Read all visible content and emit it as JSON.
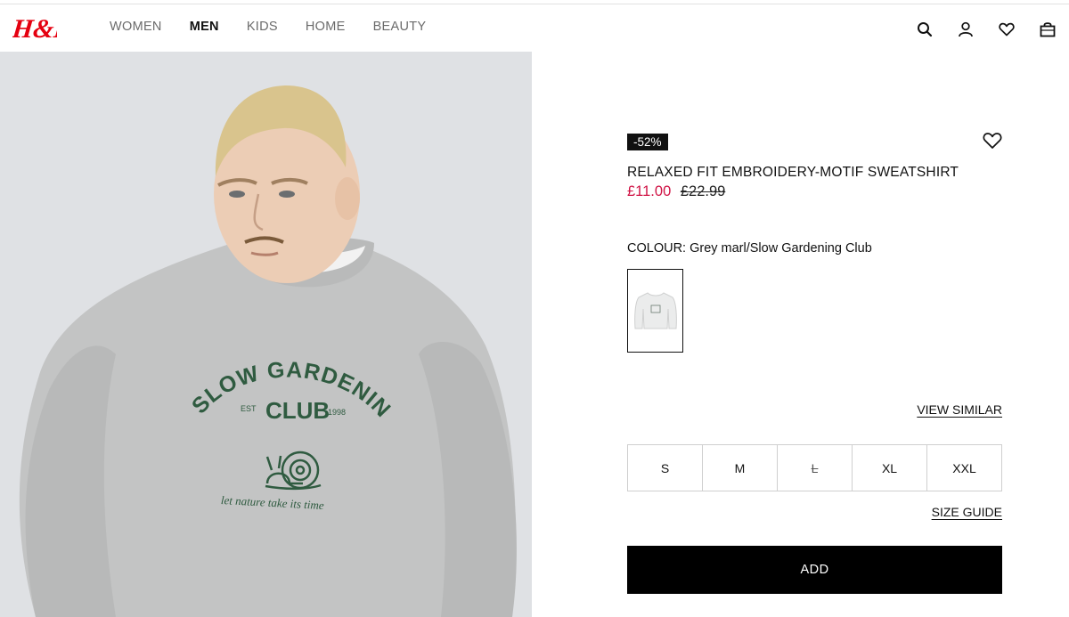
{
  "brand": {
    "logo_text": "H&M",
    "logo_color": "#e50010"
  },
  "nav": [
    "WOMEN",
    "MEN",
    "KIDS",
    "HOME",
    "BEAUTY"
  ],
  "nav_active": "MEN",
  "header_icons": [
    "search-icon",
    "account-icon",
    "favourites-icon",
    "shopping-bag-icon"
  ],
  "product": {
    "discount_badge": "-52%",
    "title": "RELAXED FIT EMBROIDERY-MOTIF SWEATSHIRT",
    "price_sale": "£11.00",
    "price_original": "£22.99",
    "colour_label": "COLOUR: Grey marl/Slow Gardening Club",
    "sale_color": "#d01345",
    "print": {
      "line1": "SLOW GARDENING",
      "line2": "CLUB",
      "est": "EST",
      "year": "1998",
      "tagline": "let nature take its time"
    }
  },
  "view_similar": "VIEW SIMILAR",
  "sizes": [
    {
      "label": "S",
      "available": true
    },
    {
      "label": "M",
      "available": true
    },
    {
      "label": "L",
      "available": false
    },
    {
      "label": "XL",
      "available": true
    },
    {
      "label": "XXL",
      "available": true
    }
  ],
  "size_guide": "SIZE GUIDE",
  "add_button": "ADD"
}
